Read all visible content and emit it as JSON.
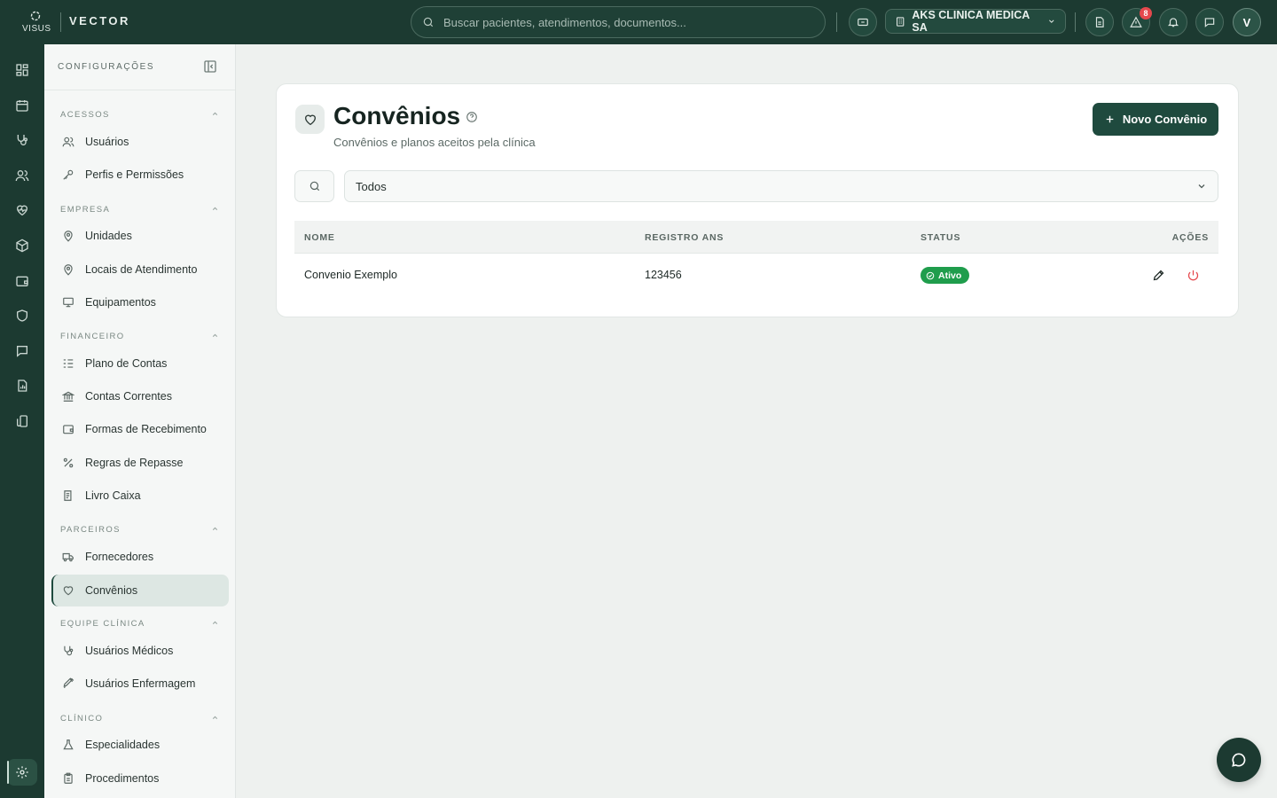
{
  "brand": {
    "logo_text": "VISUS",
    "app_name": "VECTOR"
  },
  "topbar": {
    "search_placeholder": "Buscar pacientes, atendimentos, documentos...",
    "clinic": "AKS CLINICA MEDICA SA",
    "alerts_count": "8",
    "avatar_initial": "V"
  },
  "rail": {
    "icons": [
      "dashboard-icon",
      "calendar-icon",
      "stethoscope-icon",
      "users-icon",
      "heart-pulse-icon",
      "box-icon",
      "wallet-icon",
      "shield-icon",
      "message-icon",
      "report-icon",
      "tablet-icon",
      "settings-icon"
    ],
    "active": "settings-icon"
  },
  "sidebar": {
    "title": "CONFIGURAÇÕES",
    "sections": [
      {
        "label": "ACESSOS",
        "items": [
          "Usuários",
          "Perfis e Permissões"
        ]
      },
      {
        "label": "EMPRESA",
        "items": [
          "Unidades",
          "Locais de Atendimento",
          "Equipamentos"
        ]
      },
      {
        "label": "FINANCEIRO",
        "items": [
          "Plano de Contas",
          "Contas Correntes",
          "Formas de Recebimento",
          "Regras de Repasse",
          "Livro Caixa"
        ]
      },
      {
        "label": "PARCEIROS",
        "items": [
          "Fornecedores",
          "Convênios"
        ]
      },
      {
        "label": "EQUIPE CLÍNICA",
        "items": [
          "Usuários Médicos",
          "Usuários Enfermagem"
        ]
      },
      {
        "label": "CLÍNICO",
        "items": [
          "Especialidades",
          "Procedimentos"
        ]
      }
    ],
    "active_item": "Convênios"
  },
  "page": {
    "title": "Convênios",
    "subtitle": "Convênios e planos aceitos pela clínica",
    "new_button": "Novo Convênio",
    "filter_value": "Todos"
  },
  "table": {
    "headers": {
      "name": "NOME",
      "registry": "REGISTRO ANS",
      "status": "STATUS",
      "actions": "AÇÕES"
    },
    "rows": [
      {
        "name": "Convenio Exemplo",
        "registry": "123456",
        "status": "Ativo"
      }
    ]
  },
  "colors": {
    "brand_dark": "#1c3a31",
    "accent": "#1f4a3e",
    "status_active": "#1f9d4c",
    "danger": "#e5484d"
  }
}
